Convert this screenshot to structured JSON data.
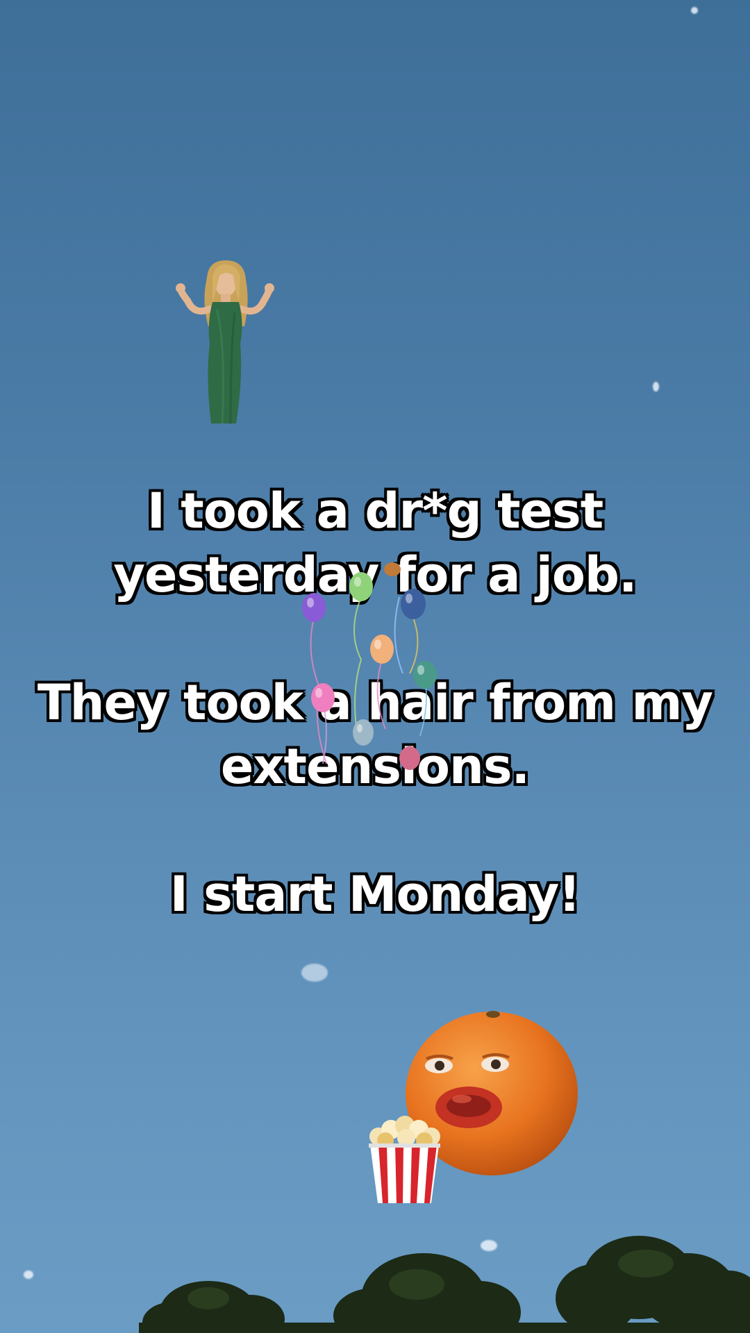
{
  "caption": {
    "line1": "I took a dr*g test",
    "line2": "yesterday for a job.",
    "line3": "They took a hair from my",
    "line4": "extensions.",
    "line5": "I start Monday!"
  },
  "stickers": {
    "woman": "woman-in-green-dress",
    "balloons": "party-balloons",
    "orange": "annoying-orange-face",
    "popcorn": "popcorn-bucket",
    "trees": "tree-canopy-silhouette"
  },
  "colors": {
    "sky_top": "#3e6f99",
    "sky_bottom": "#6a9cc4",
    "caption_text": "#ffffff",
    "caption_outline": "#000000",
    "orange": "#e8731f",
    "dress": "#2f6b45"
  }
}
